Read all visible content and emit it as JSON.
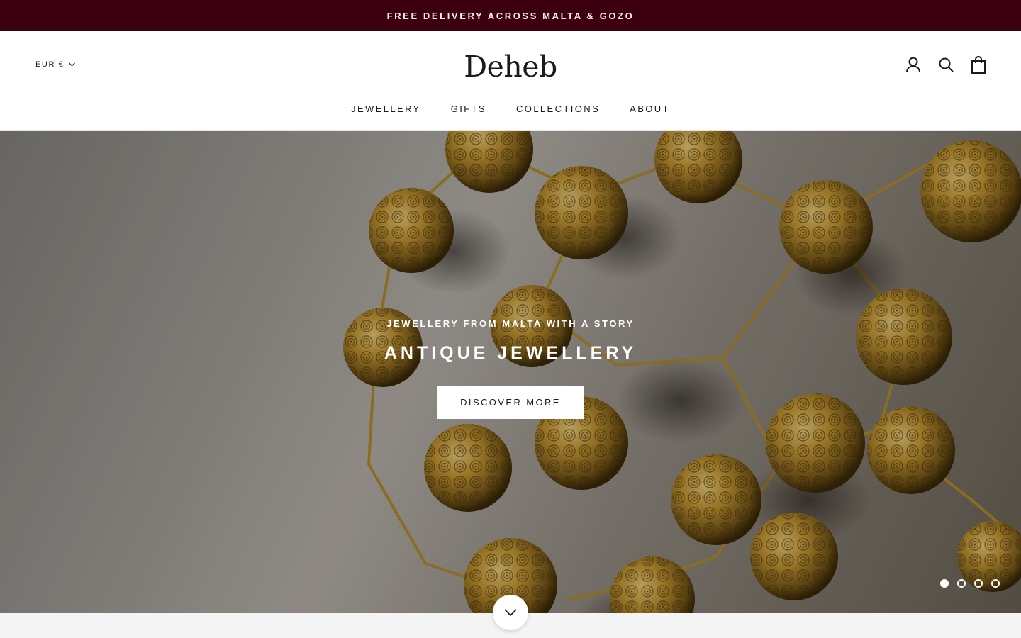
{
  "announcement": {
    "text": "FREE DELIVERY ACROSS MALTA & GOZO"
  },
  "header": {
    "currency_label": "EUR €",
    "logo_text": "Deheb",
    "icons": [
      "account-icon",
      "search-icon",
      "cart-icon"
    ]
  },
  "nav": {
    "items": [
      {
        "label": "JEWELLERY"
      },
      {
        "label": "GIFTS"
      },
      {
        "label": "COLLECTIONS"
      },
      {
        "label": "ABOUT"
      }
    ]
  },
  "hero": {
    "subtitle": "JEWELLERY FROM MALTA WITH A STORY",
    "title": "ANTIQUE JEWELLERY",
    "button_label": "DISCOVER MORE",
    "slide_count": 4,
    "active_slide": 1
  },
  "colors": {
    "announcement_bg": "#3d0011",
    "text": "#1c1b1b",
    "gold": "#b8902e"
  }
}
